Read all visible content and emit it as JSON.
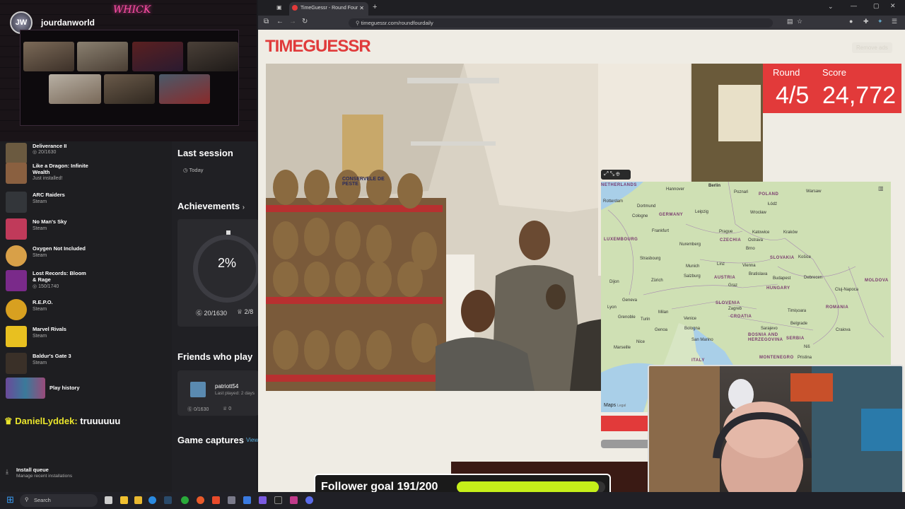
{
  "stream": {
    "channel_name": "jourdanworld",
    "neon_sign": "WHICK",
    "chat_user": "DanielLyddek:",
    "chat_message": "truuuuuu",
    "follower_goal": "Follower goal 191/200",
    "follower_progress": 0.955
  },
  "xbox": {
    "games": [
      {
        "title": "Deliverance II",
        "sub": "20/1630"
      },
      {
        "title": "Like a Dragon: Infinite Wealth",
        "sub": "Just installed!"
      },
      {
        "title": "ARC Raiders",
        "sub": "Steam"
      },
      {
        "title": "No Man's Sky",
        "sub": "Steam"
      },
      {
        "title": "Oxygen Not Included",
        "sub": "Steam"
      },
      {
        "title": "Lost Records: Bloom & Rage",
        "sub": "150/1740"
      },
      {
        "title": "R.E.P.O.",
        "sub": "Steam"
      },
      {
        "title": "Marvel Rivals",
        "sub": "Steam"
      },
      {
        "title": "Baldur's Gate 3",
        "sub": "Steam"
      },
      {
        "title": "Play history",
        "sub": ""
      }
    ],
    "last_session": "Last session",
    "today": "Today",
    "achievements": "Achievements",
    "ach_percent": "2%",
    "ach_score": "20/1630",
    "ach_count": "2/8",
    "friends_title": "Friends who play",
    "friend_name": "patriott54",
    "friend_last": "Last played: 2 days",
    "friend_score": "0/1630",
    "friend_count": "0",
    "captures": "Game captures",
    "captures_link": "View",
    "install_queue": "Install queue",
    "install_sub": "Manage recent installations"
  },
  "browser": {
    "tab_title": "TimeGuessr - Round Four",
    "url": "timeguessr.com/roundfourdaily",
    "logo": "TIMEGUESSR",
    "remove_ads": "Remove ads",
    "round_label": "Round",
    "score_label": "Score",
    "round_value": "4/5",
    "score_value": "24,772",
    "map_attribution": "Maps",
    "map_legal": "Legal",
    "photo_sign": "CONSERVELE DE PESTE"
  },
  "map": {
    "countries": [
      "NETHERLANDS",
      "GERMANY",
      "POLAND",
      "CZECHIA",
      "SLOVAKIA",
      "AUSTRIA",
      "HUNGARY",
      "SLOVENIA",
      "CROATIA",
      "ROMANIA",
      "BOSNIA AND HERZEGOVINA",
      "SERBIA",
      "MONTENEGRO",
      "LUXEMBOURG",
      "MOLDOVA",
      "ITALY"
    ],
    "cities": [
      "Berlin",
      "Hannover",
      "Poznań",
      "Warsaw",
      "Łódź",
      "Rotterdam",
      "Dortmund",
      "Leipzig",
      "Wrocław",
      "Cologne",
      "Frankfurt",
      "Prague",
      "Katowice",
      "Kraków",
      "Nuremberg",
      "Ostrava",
      "Brno",
      "Strasbourg",
      "Munich",
      "Linz",
      "Vienna",
      "Košice",
      "Salzburg",
      "Bratislava",
      "Budapest",
      "Debrecen",
      "Dijon",
      "Zürich",
      "Graz",
      "Cluj-Napoca",
      "Lyon",
      "Geneva",
      "Milan",
      "Zagreb",
      "Timișoara",
      "Grenoble",
      "Turin",
      "Venice",
      "Belgrade",
      "Genoa",
      "Bologna",
      "Craiova",
      "Marseille",
      "Nice",
      "San Marino",
      "Sarajevo",
      "Niš",
      "Pristina"
    ]
  },
  "taskbar": {
    "search_placeholder": "Search"
  }
}
